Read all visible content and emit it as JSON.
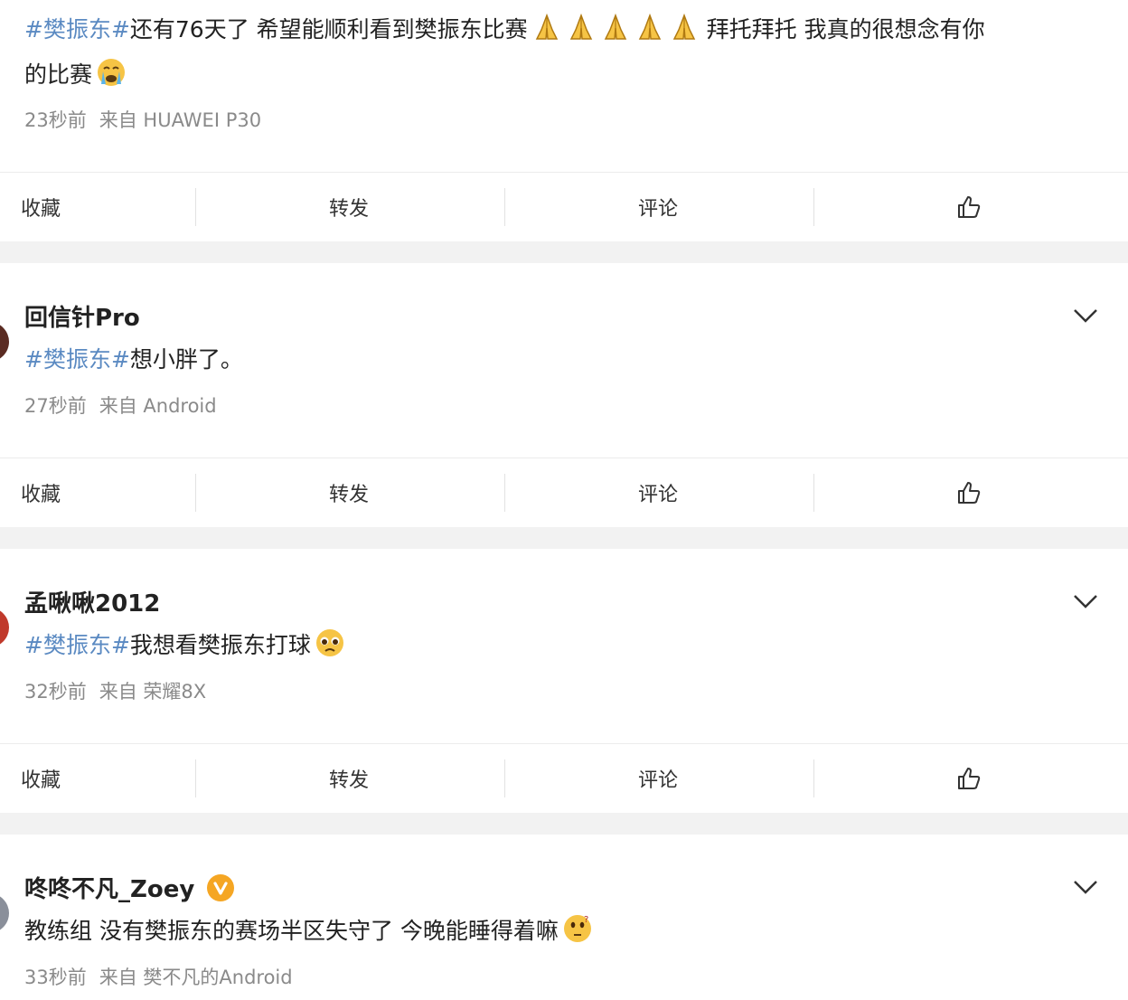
{
  "posts": [
    {
      "username": "",
      "tag": "#樊振东#",
      "text": "还有76天了 希望能顺利看到樊振东比赛",
      "text_after_emoji": " 拜托拜托 我真的很想念有你",
      "text_line2": "的比赛",
      "emojis": [
        "folded-hands-emoji",
        "folded-hands-emoji",
        "folded-hands-emoji",
        "folded-hands-emoji",
        "folded-hands-emoji"
      ],
      "end_emoji": "crying-face-emoji",
      "time": "23秒前",
      "source": "来自 HUAWEI P30"
    },
    {
      "username": "回信针Pro",
      "tag": "#樊振东#",
      "text": "想小胖了。",
      "time": "27秒前",
      "source": "来自 Android"
    },
    {
      "username": "孟啾啾2012",
      "tag": "#樊振东#",
      "text": "我想看樊振东打球",
      "end_emoji": "pleading-face-emoji",
      "time": "32秒前",
      "source": "来自 荣耀8X"
    },
    {
      "username": "咚咚不凡_Zoey",
      "verified": true,
      "tag": "",
      "text": "教练组 没有樊振东的赛场半区失守了 今晚能睡得着嘛",
      "end_emoji": "thinking-face-emoji",
      "time": "33秒前",
      "source": "来自 樊不凡的Android"
    }
  ],
  "actions": {
    "favorite": "收藏",
    "repost": "转发",
    "comment": "评论",
    "like_icon": "thumbs-up-icon"
  },
  "colors": {
    "tag": "#5b8ac2",
    "meta": "#8a8a8a",
    "background": "#f2f2f2",
    "verified": "#f5a623"
  }
}
